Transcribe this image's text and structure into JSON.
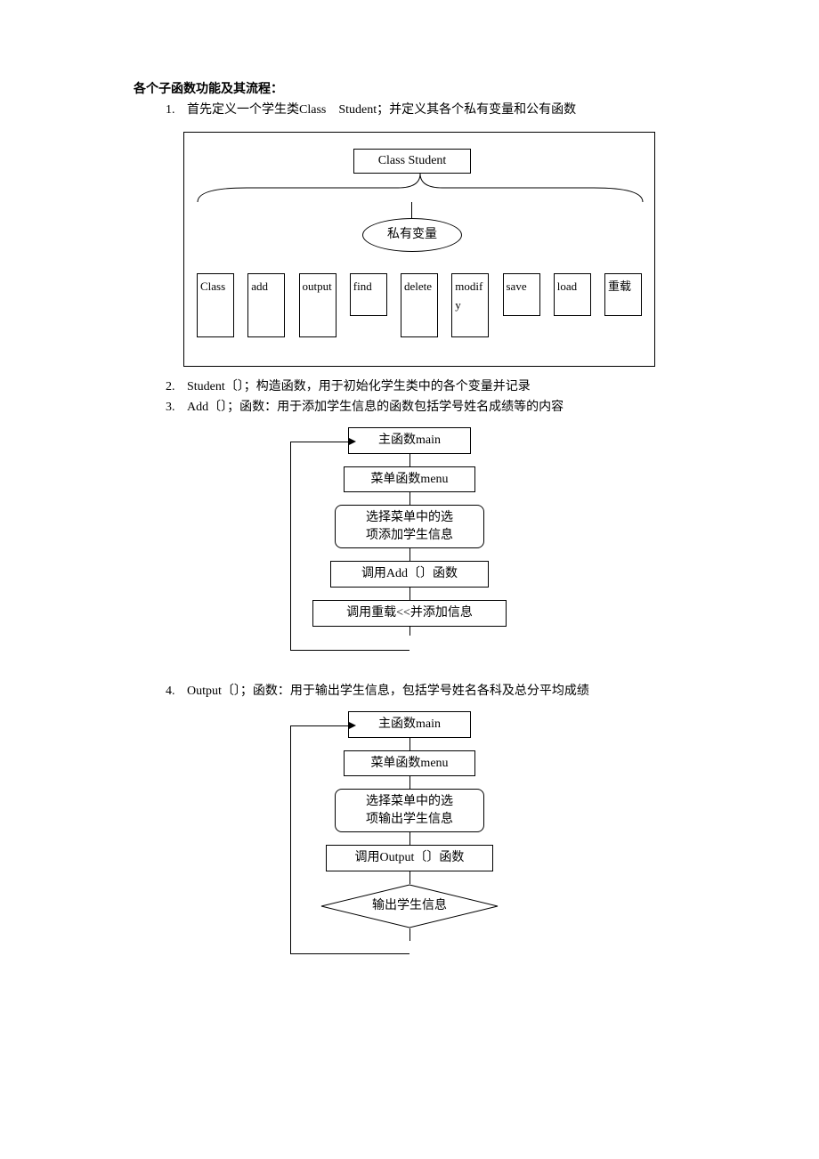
{
  "heading": "各个子函数功能及其流程：",
  "list": [
    {
      "num": "1.",
      "text": "首先定义一个学生类Class Student；并定义其各个私有变量和公有函数"
    },
    {
      "num": "2.",
      "text": "Student〔〕；构造函数，用于初始化学生类中的各个变量并记录"
    },
    {
      "num": "3.",
      "text": "Add〔〕；函数：用于添加学生信息的函数包括学号姓名成绩等的内容"
    },
    {
      "num": "4.",
      "text": "Output〔〕；函数：用于输出学生信息，包括学号姓名各科及总分平均成绩"
    }
  ],
  "diagram1": {
    "class_box": "Class Student",
    "private_label": "私有变量",
    "members": [
      {
        "txt": "Class",
        "h": "tall"
      },
      {
        "txt": "add",
        "h": "tall"
      },
      {
        "txt": "output",
        "h": "tall"
      },
      {
        "txt": "find",
        "h": "short"
      },
      {
        "txt": "delete",
        "h": "tall"
      },
      {
        "txt": "modify",
        "h": "tall"
      },
      {
        "txt": "save",
        "h": "short"
      },
      {
        "txt": "load",
        "h": "short"
      },
      {
        "txt": "重载",
        "h": "short"
      }
    ]
  },
  "flow_add": {
    "n1": "主函数main",
    "n2": "菜单函数menu",
    "n3a": "选择菜单中的选",
    "n3b": "项添加学生信息",
    "n4": "调用Add〔〕函数",
    "n5": "调用重载<<并添加信息"
  },
  "flow_output": {
    "n1": "主函数main",
    "n2": "菜单函数menu",
    "n3a": "选择菜单中的选",
    "n3b": "项输出学生信息",
    "n4": "调用Output〔〕函数",
    "n5": "输出学生信息"
  }
}
